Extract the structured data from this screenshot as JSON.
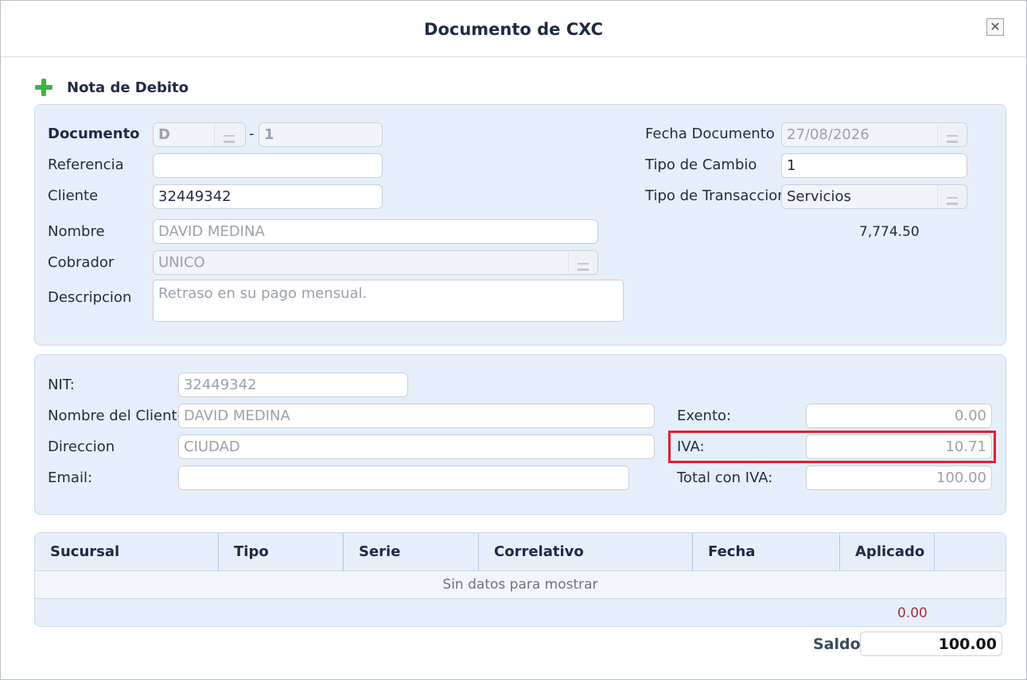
{
  "dialog": {
    "title": "Documento de CXC",
    "close_glyph": "✕"
  },
  "section": {
    "title": "Nota de Debito",
    "icon": "plus-icon"
  },
  "header": {
    "documento_label": "Documento",
    "documento_serie": "D",
    "documento_sep": "-",
    "documento_numero": "1",
    "referencia_label": "Referencia",
    "referencia_value": "",
    "cliente_label": "Cliente",
    "cliente_value": "32449342",
    "nombre_label": "Nombre",
    "nombre_value": "DAVID MEDINA",
    "cobrador_label": "Cobrador",
    "cobrador_value": "UNICO",
    "descripcion_label": "Descripcion",
    "descripcion_value": "Retraso en su pago mensual.",
    "fecha_label": "Fecha Documento",
    "fecha_value": "27/08/2026",
    "tipo_cambio_label": "Tipo de Cambio",
    "tipo_cambio_value": "1",
    "tipo_transaccion_label": "Tipo de Transaccion",
    "tipo_transaccion_value": "Servicios",
    "saldo_cliente": "7,774.50"
  },
  "factura": {
    "nit_label": "NIT:",
    "nit_value": "32449342",
    "nombre_cliente_label": "Nombre del Cliente",
    "nombre_cliente_value": "DAVID MEDINA",
    "direccion_label": "Direccion",
    "direccion_value": "CIUDAD",
    "email_label": "Email:",
    "email_value": "",
    "exento_label": "Exento:",
    "exento_value": "0.00",
    "iva_label": "IVA:",
    "iva_value": "10.71",
    "total_label": "Total con IVA:",
    "total_value": "100.00"
  },
  "grid": {
    "columns": [
      "Sucursal",
      "Tipo",
      "Serie",
      "Correlativo",
      "Fecha",
      "Aplicado"
    ],
    "empty_text": "Sin datos para mostrar",
    "total_aplicado": "0.00"
  },
  "saldo": {
    "label": "Saldo",
    "value": "100.00"
  },
  "colors": {
    "accent_green": "#3fb24a",
    "highlight_red": "#e0202e",
    "panel_bg": "#e6eff9",
    "total_red": "#a2343a"
  }
}
